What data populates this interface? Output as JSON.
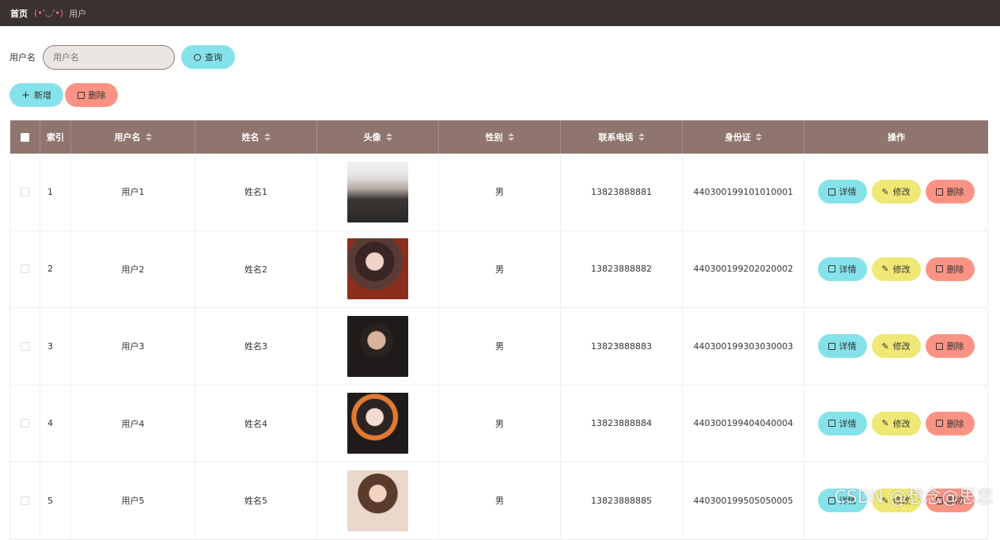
{
  "breadcrumb": {
    "home": "首页",
    "separator": "(•'◡'•)",
    "current": "用户"
  },
  "search": {
    "label": "用户名",
    "placeholder": "用户名",
    "button_label": "查询",
    "button_icon": "search-icon"
  },
  "actions": {
    "add_label": "新增",
    "add_icon": "plus-icon",
    "delete_label": "删除",
    "delete_icon": "trash-icon"
  },
  "table": {
    "columns": [
      "索引",
      "用户名",
      "姓名",
      "头像",
      "性别",
      "联系电话",
      "身份证",
      "操作"
    ],
    "rows": [
      {
        "index": "1",
        "username": "用户1",
        "name": "姓名1",
        "gender": "男",
        "phone": "13823888881",
        "id_card": "440300199101010001"
      },
      {
        "index": "2",
        "username": "用户2",
        "name": "姓名2",
        "gender": "男",
        "phone": "13823888882",
        "id_card": "440300199202020002"
      },
      {
        "index": "3",
        "username": "用户3",
        "name": "姓名3",
        "gender": "男",
        "phone": "13823888883",
        "id_card": "440300199303030003"
      },
      {
        "index": "4",
        "username": "用户4",
        "name": "姓名4",
        "gender": "男",
        "phone": "13823888884",
        "id_card": "440300199404040004"
      },
      {
        "index": "5",
        "username": "用户5",
        "name": "姓名5",
        "gender": "男",
        "phone": "13823888885",
        "id_card": "440300199505050005"
      }
    ],
    "row_actions": {
      "detail": "详情",
      "edit": "修改",
      "delete": "删除"
    }
  },
  "watermark": "CSDN @想念@思恋",
  "colors": {
    "topbar": "#3a3230",
    "header": "#8f756d",
    "cyan": "#86e2ea",
    "red": "#fb9384",
    "yellow": "#efe874"
  }
}
